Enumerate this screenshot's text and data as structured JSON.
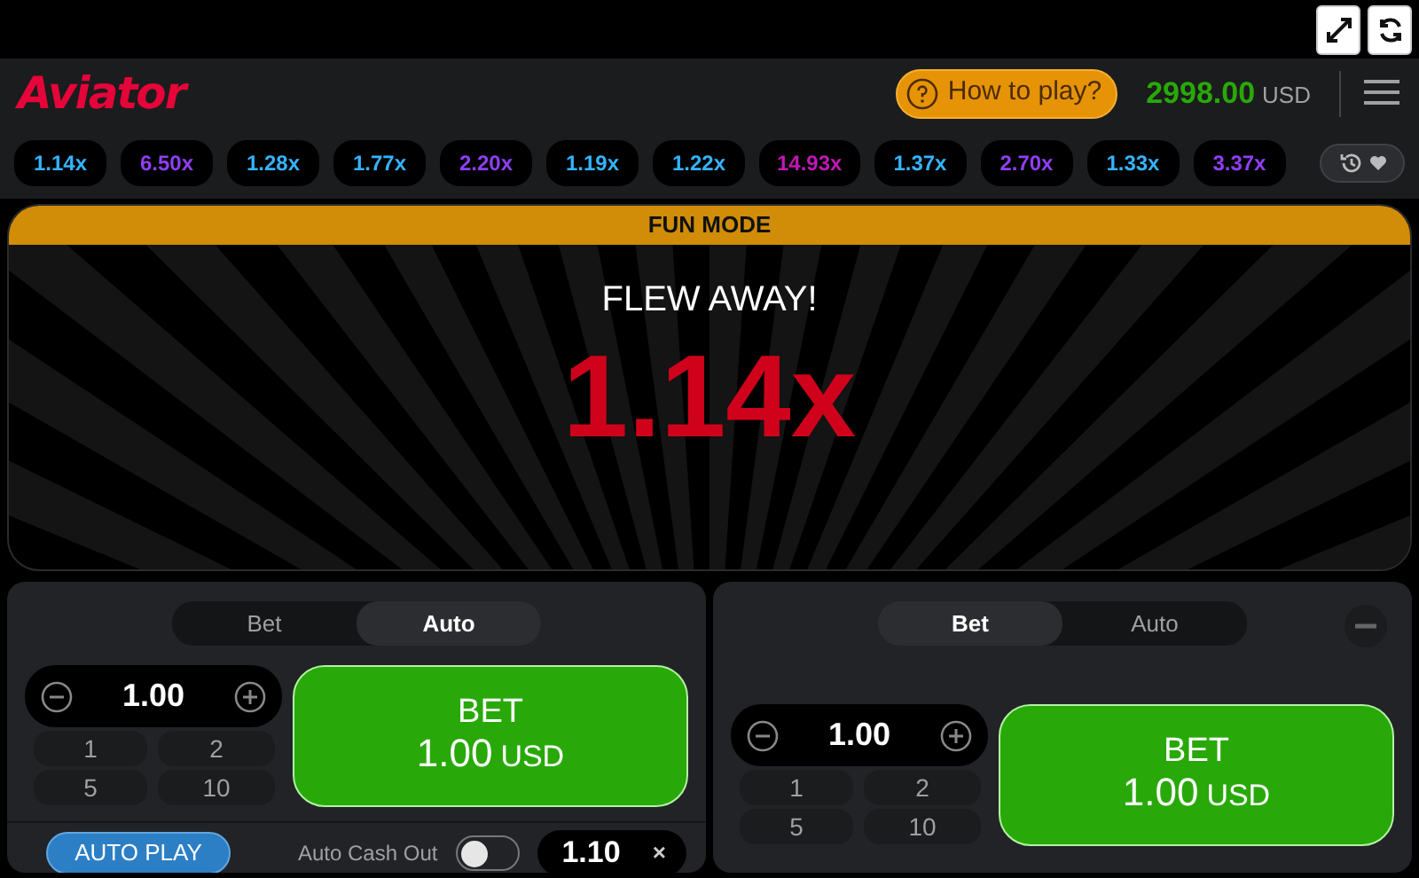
{
  "header": {
    "logo": "Aviator",
    "help_button": "How to play?",
    "balance": "2998.00",
    "currency": "USD"
  },
  "multipliers": [
    {
      "value": "1.14x",
      "color": "#34b4ff"
    },
    {
      "value": "6.50x",
      "color": "#913ef8"
    },
    {
      "value": "1.28x",
      "color": "#34b4ff"
    },
    {
      "value": "1.77x",
      "color": "#34b4ff"
    },
    {
      "value": "2.20x",
      "color": "#913ef8"
    },
    {
      "value": "1.19x",
      "color": "#34b4ff"
    },
    {
      "value": "1.22x",
      "color": "#34b4ff"
    },
    {
      "value": "14.93x",
      "color": "#c017b4"
    },
    {
      "value": "1.37x",
      "color": "#34b4ff"
    },
    {
      "value": "2.70x",
      "color": "#913ef8"
    },
    {
      "value": "1.33x",
      "color": "#34b4ff"
    },
    {
      "value": "3.37x",
      "color": "#913ef8"
    }
  ],
  "game": {
    "banner": "FUN MODE",
    "status": "FLEW AWAY!",
    "multiplier": "1.14x"
  },
  "bet_panels": [
    {
      "tabs": [
        {
          "label": "Bet",
          "selected": false
        },
        {
          "label": "Auto",
          "selected": true
        }
      ],
      "removable": false,
      "amount": "1.00",
      "quick_amounts": [
        "1",
        "2",
        "5",
        "10"
      ],
      "bet_button": {
        "label": "BET",
        "amount": "1.00",
        "currency": "USD"
      },
      "auto": {
        "button": "AUTO PLAY",
        "cash_out_label": "Auto Cash Out",
        "cash_out_on": false,
        "cash_out_value": "1.10",
        "clear": "×"
      }
    },
    {
      "tabs": [
        {
          "label": "Bet",
          "selected": true
        },
        {
          "label": "Auto",
          "selected": false
        }
      ],
      "removable": true,
      "amount": "1.00",
      "quick_amounts": [
        "1",
        "2",
        "5",
        "10"
      ],
      "bet_button": {
        "label": "BET",
        "amount": "1.00",
        "currency": "USD"
      }
    }
  ]
}
